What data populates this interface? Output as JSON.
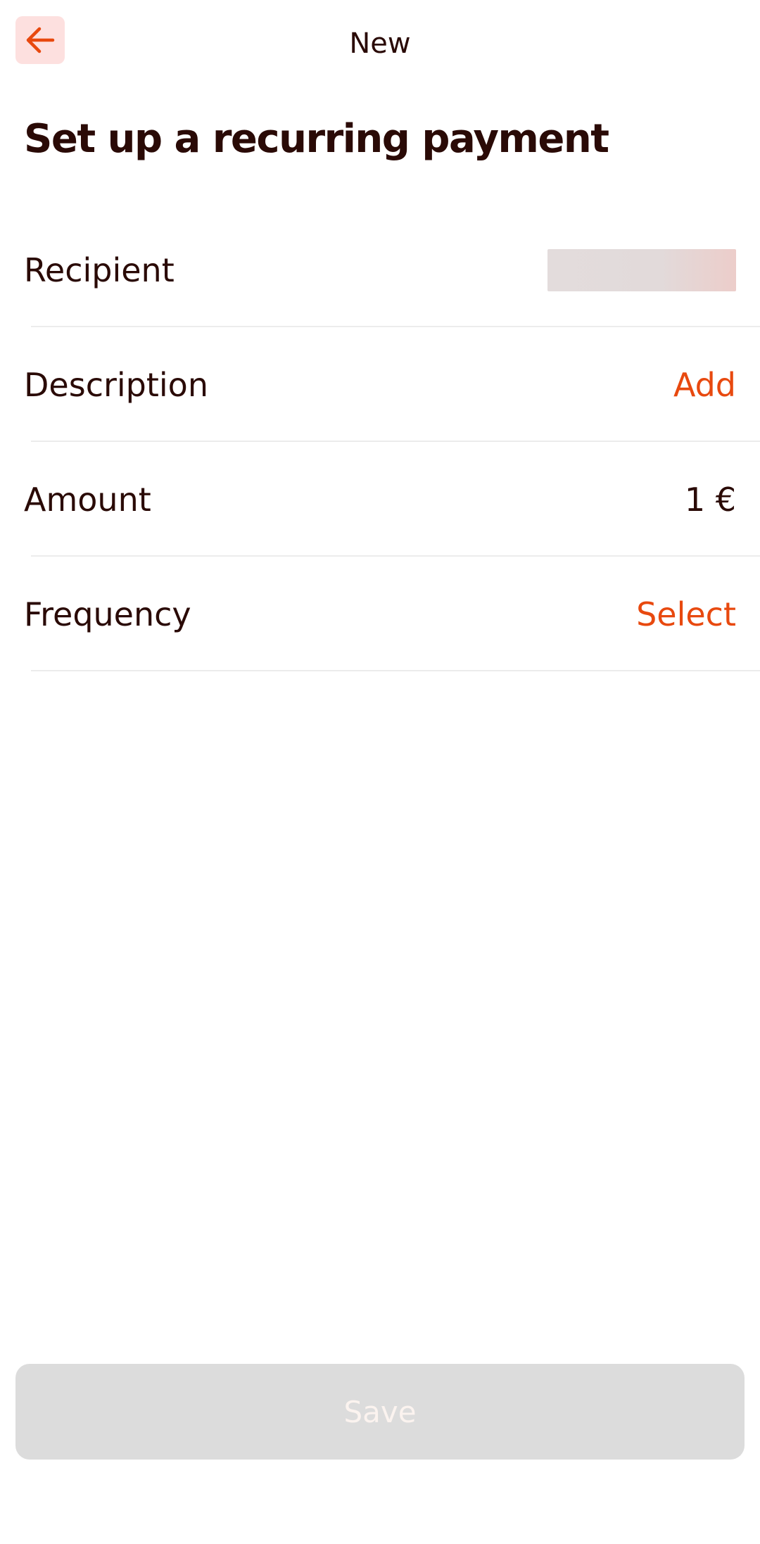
{
  "header": {
    "back_icon": "arrow-left-icon",
    "title": "New"
  },
  "page": {
    "title": "Set up a recurring payment"
  },
  "form": {
    "rows": [
      {
        "label": "Recipient",
        "value": ""
      },
      {
        "label": "Description",
        "value": "Add"
      },
      {
        "label": "Amount",
        "value": "1 €"
      },
      {
        "label": "Frequency",
        "value": "Select"
      }
    ]
  },
  "footer": {
    "save_label": "Save"
  },
  "colors": {
    "accent": "#e8490f",
    "text": "#2a0a06",
    "back_button_bg": "#fde0df",
    "disabled_button_bg": "#dcdcdc",
    "disabled_button_text": "#fbf3ef",
    "divider": "#ececec"
  }
}
